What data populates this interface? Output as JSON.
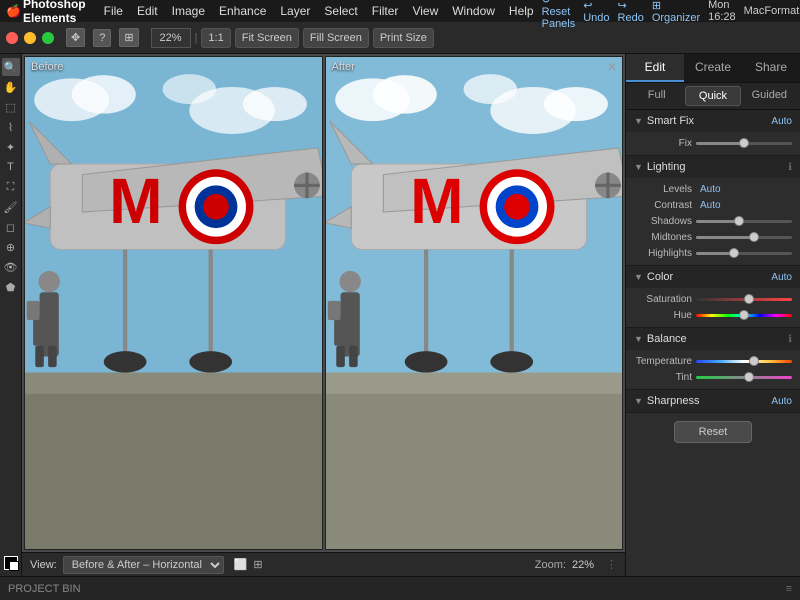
{
  "menubar": {
    "apple": "🍎",
    "app_name": "Photoshop Elements",
    "menus": [
      "File",
      "Edit",
      "Image",
      "Enhance",
      "Layer",
      "Select",
      "Filter",
      "View",
      "Window",
      "Help"
    ],
    "right": {
      "reset_panels": "↺ Reset Panels",
      "undo": "↩ Undo",
      "redo": "↪ Redo",
      "organizer": "⊞ Organizer",
      "time": "Mon 16:28",
      "format": "MacFormat"
    }
  },
  "toolbar": {
    "zoom_value": "22%",
    "zoom_separator": "|",
    "ratio": "1:1",
    "fit_screen": "Fit Screen",
    "fill_screen": "Fill Screen",
    "print_size": "Print Size"
  },
  "panels": {
    "before_label": "Before",
    "after_label": "After"
  },
  "bottom_bar": {
    "view_label": "View:",
    "view_option": "Before & After – Horizontal",
    "zoom_label": "Zoom:",
    "zoom_value": "22%"
  },
  "right_panel": {
    "mode_tabs": [
      "Edit",
      "Create",
      "Share"
    ],
    "active_mode": "Edit",
    "sub_tabs": [
      "Full",
      "Quick",
      "Guided"
    ],
    "active_sub": "Quick",
    "sections": {
      "smart_fix": {
        "title": "Smart Fix",
        "auto_label": "Auto",
        "fix_label": "Fix",
        "fix_value": 50
      },
      "lighting": {
        "title": "Lighting",
        "levels_label": "Levels",
        "levels_value": "Auto",
        "contrast_label": "Contrast",
        "contrast_value": "Auto",
        "shadows_label": "Shadows",
        "shadows_value": 45,
        "midtones_label": "Midtones",
        "midtones_value": 60,
        "highlights_label": "Highlights",
        "highlights_value": 40
      },
      "color": {
        "title": "Color",
        "auto_label": "Auto",
        "saturation_label": "Saturation",
        "saturation_value": 55,
        "hue_label": "Hue",
        "hue_value": 50
      },
      "balance": {
        "title": "Balance",
        "info_icon": "ℹ",
        "temperature_label": "Temperature",
        "temperature_value": 60,
        "tint_label": "Tint",
        "tint_value": 55
      },
      "sharpness": {
        "title": "Sharpness",
        "auto_label": "Auto"
      }
    },
    "reset_label": "Reset"
  },
  "project_bin": {
    "label": "PROJECT BIN"
  }
}
